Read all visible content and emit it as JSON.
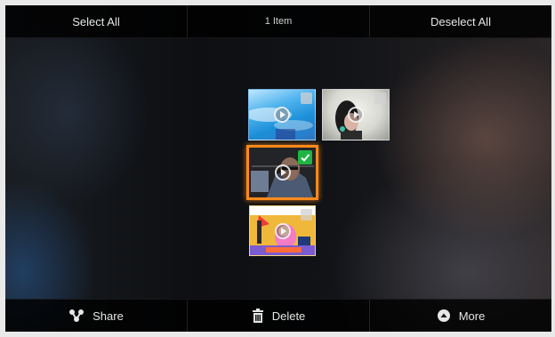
{
  "top_bar": {
    "select_all_label": "Select All",
    "selection_count": "1 Item",
    "deselect_all_label": "Deselect All"
  },
  "grid": {
    "items": [
      {
        "kind": "video",
        "selected": false,
        "icon": "play-icon"
      },
      {
        "kind": "video",
        "selected": false,
        "icon": "play-icon"
      },
      {
        "kind": "video",
        "selected": true,
        "icon": "play-icon"
      },
      {
        "kind": "video",
        "selected": false,
        "icon": "play-icon"
      }
    ]
  },
  "bottom_bar": {
    "share_label": "Share",
    "delete_label": "Delete",
    "more_label": "More"
  },
  "colors": {
    "selection_border": "#ff8a1a",
    "check_selected": "#1fb542"
  }
}
